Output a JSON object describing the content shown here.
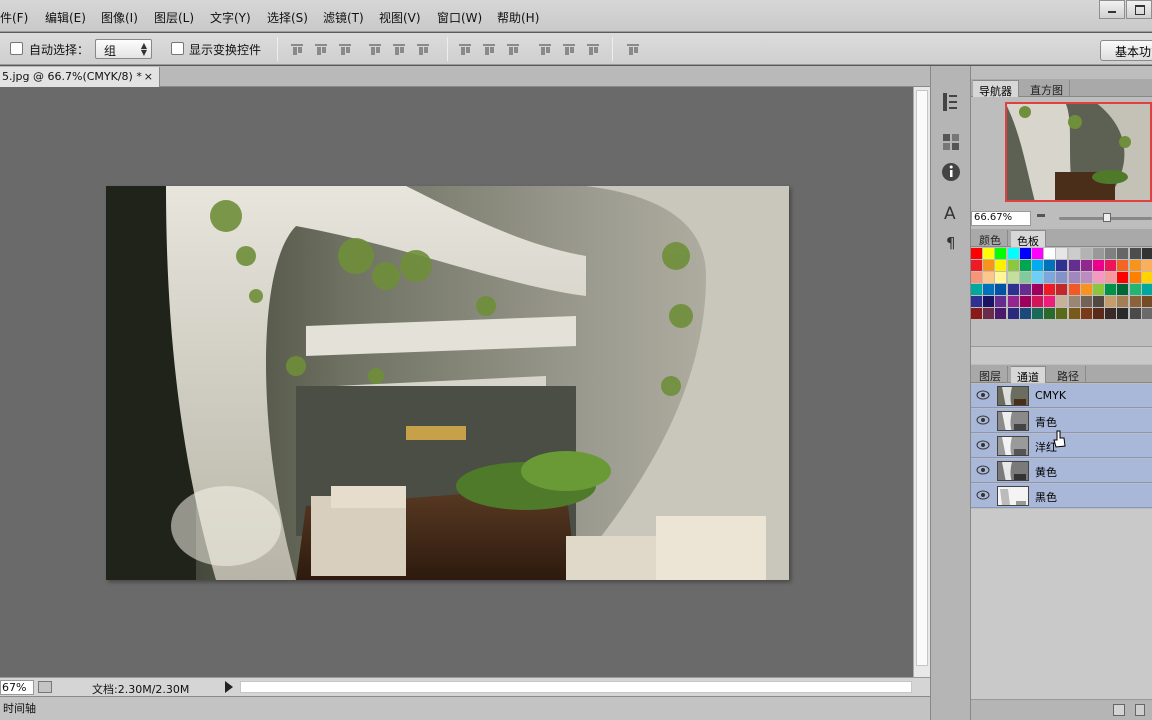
{
  "menu": {
    "items": [
      "件(F)",
      "编辑(E)",
      "图像(I)",
      "图层(L)",
      "文字(Y)",
      "选择(S)",
      "滤镜(T)",
      "视图(V)",
      "窗口(W)",
      "帮助(H)"
    ]
  },
  "options": {
    "auto_select_label": "自动选择：",
    "auto_select_value": "组",
    "show_transform_label": "显示变换控件",
    "workspace_label": "基本功能"
  },
  "document": {
    "tab_title": "5.jpg @ 66.7%(CMYK/8) *",
    "close_glyph": "×"
  },
  "status": {
    "zoom": "67%",
    "doc_info": "文档:2.30M/2.30M",
    "timeline_label": "时间轴"
  },
  "panels": {
    "navigator_tabs": [
      "导航器",
      "直方图"
    ],
    "navigator_zoom": "66.67%",
    "color_tabs": [
      "颜色",
      "色板"
    ],
    "layer_tabs": [
      "图层",
      "通道",
      "路径"
    ],
    "channels": [
      "CMYK",
      "青色",
      "洋红",
      "黄色",
      "黑色"
    ]
  },
  "colors": {
    "accent_selected_row": "#a9b8d8",
    "nav_frame": "#e04040"
  },
  "icons": [
    "eye-icon",
    "history-icon",
    "properties-icon",
    "info-icon",
    "character-icon",
    "paragraph-icon"
  ]
}
